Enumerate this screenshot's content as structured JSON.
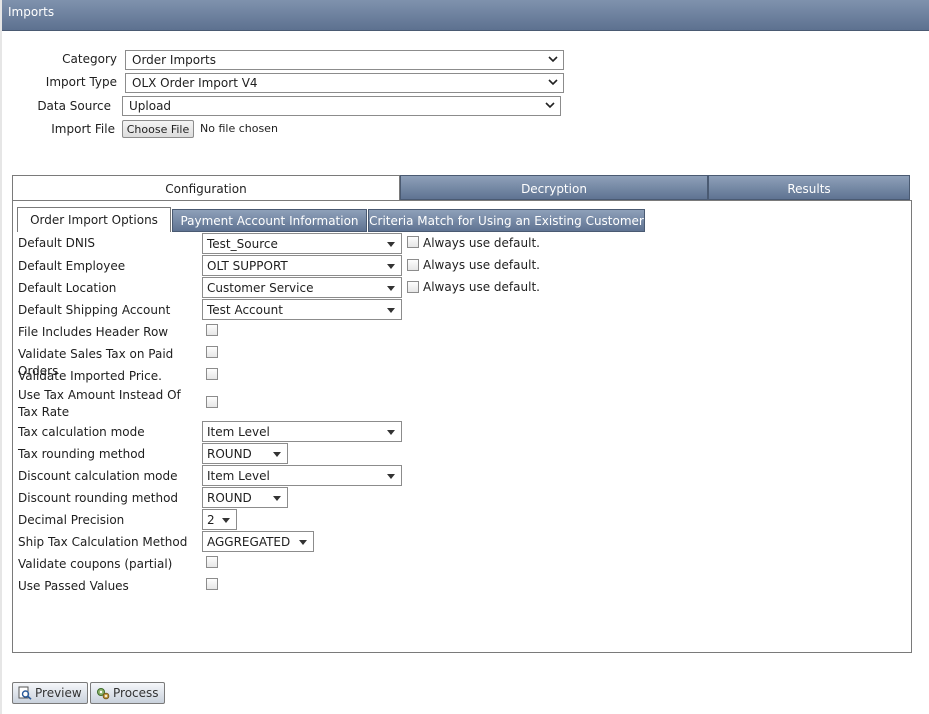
{
  "window": {
    "title": "Imports"
  },
  "form": {
    "category": {
      "label": "Category",
      "value": "Order Imports"
    },
    "import_type": {
      "label": "Import Type",
      "value": "OLX Order Import V4"
    },
    "data_source": {
      "label": "Data Source",
      "value": "Upload"
    },
    "import_file": {
      "label": "Import File",
      "button": "Choose File",
      "status": "No file chosen"
    }
  },
  "tabs": [
    {
      "label": "Configuration",
      "active": true
    },
    {
      "label": "Decryption",
      "active": false
    },
    {
      "label": "Results",
      "active": false
    }
  ],
  "subtabs": [
    {
      "label": "Order Import Options",
      "active": true
    },
    {
      "label": "Payment Account Information",
      "active": false
    },
    {
      "label": "Criteria Match for Using an Existing Customer",
      "active": false
    }
  ],
  "options": {
    "always_default_label": "Always use default.",
    "default_dnis": {
      "label": "Default DNIS",
      "value": "Test_Source",
      "always_default": false
    },
    "default_employee": {
      "label": "Default Employee",
      "value": "OLT SUPPORT",
      "always_default": false
    },
    "default_location": {
      "label": "Default Location",
      "value": "Customer Service",
      "always_default": false
    },
    "default_shipping_account": {
      "label": "Default Shipping Account",
      "value": "Test Account"
    },
    "file_includes_header_row": {
      "label": "File Includes Header Row",
      "checked": false
    },
    "validate_sales_tax": {
      "label": "Validate Sales Tax on Paid Orders",
      "checked": false
    },
    "validate_imported_price": {
      "label": "Validate Imported Price.",
      "checked": false
    },
    "use_tax_amount": {
      "label": "Use Tax Amount Instead Of Tax Rate",
      "checked": false
    },
    "tax_calculation_mode": {
      "label": "Tax calculation mode",
      "value": "Item Level"
    },
    "tax_rounding_method": {
      "label": "Tax rounding method",
      "value": "ROUND"
    },
    "discount_calculation_mode": {
      "label": "Discount calculation mode",
      "value": "Item Level"
    },
    "discount_rounding_method": {
      "label": "Discount rounding method",
      "value": "ROUND"
    },
    "decimal_precision": {
      "label": "Decimal Precision",
      "value": "2"
    },
    "ship_tax_calculation_method": {
      "label": "Ship Tax Calculation Method",
      "value": "AGGREGATED"
    },
    "validate_coupons": {
      "label": "Validate coupons (partial)",
      "checked": false
    },
    "use_passed_values": {
      "label": "Use Passed Values",
      "checked": false
    }
  },
  "actions": {
    "preview": "Preview",
    "process": "Process"
  },
  "colors": {
    "tab_header": "#6b7f9c",
    "panel_border": "#7a7a7a"
  }
}
